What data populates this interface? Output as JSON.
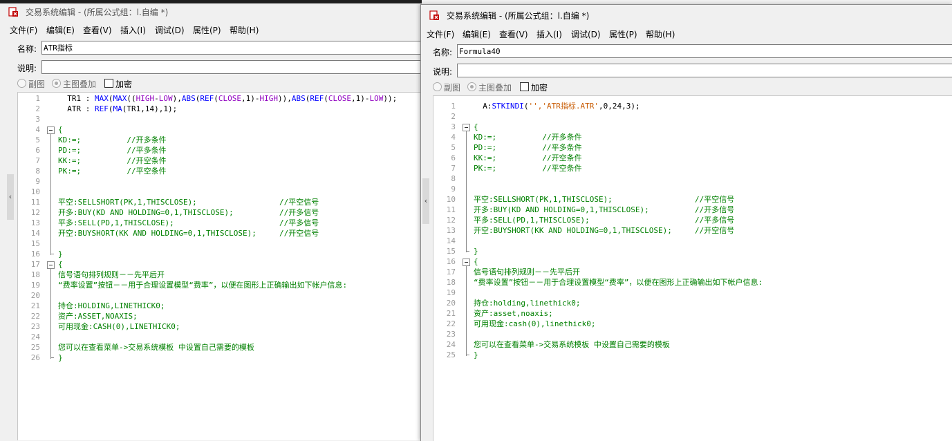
{
  "left": {
    "title": "交易系统编辑 - (所属公式组：l.自编 *)",
    "menu": [
      "文件(F)",
      "编辑(E)",
      "查看(V)",
      "插入(I)",
      "调试(D)",
      "属性(P)",
      "帮助(H)"
    ],
    "name_label": "名称:",
    "name_value": "ATR指标",
    "desc_label": "说明:",
    "desc_value": "",
    "options": {
      "sub": "副图",
      "main": "主图叠加",
      "encrypt": "加密"
    },
    "lines": [
      [
        "  TR1 : ",
        "MAX",
        "(",
        "MAX",
        "((",
        "HIGH",
        "-",
        "LOW",
        "),",
        "ABS",
        "(",
        "REF",
        "(",
        "CLOSE",
        ",1)-",
        "HIGH",
        ")),",
        "ABS",
        "(",
        "REF",
        "(",
        "CLOSE",
        ",1)-",
        "LOW",
        "));"
      ],
      [
        "  ATR : ",
        "REF",
        "(",
        "MA",
        "(TR1,14),1);"
      ],
      [
        ""
      ],
      [
        "{"
      ],
      [
        "KD:=;          //开多条件"
      ],
      [
        "PD:=;          //平多条件"
      ],
      [
        "KK:=;          //开空条件"
      ],
      [
        "PK:=;          //平空条件"
      ],
      [
        ""
      ],
      [
        ""
      ],
      [
        "平空:SELLSHORT(PK,1,THISCLOSE);                  //平空信号"
      ],
      [
        "开多:BUY(KD AND HOLDING=0,1,THISCLOSE);          //开多信号"
      ],
      [
        "平多:SELL(PD,1,THISCLOSE);                       //平多信号"
      ],
      [
        "开空:BUYSHORT(KK AND HOLDING=0,1,THISCLOSE);     //开空信号"
      ],
      [
        ""
      ],
      [
        "}"
      ],
      [
        "{"
      ],
      [
        "信号语句排列规则－－先平后开"
      ],
      [
        "“费率设置”按钮－－用于合理设置模型“费率”，以便在图形上正确输出如下帐户信息:"
      ],
      [
        ""
      ],
      [
        "持仓:HOLDING,LINETHICK0;"
      ],
      [
        "资产:ASSET,NOAXIS;"
      ],
      [
        "可用现金:CASH(0),LINETHICK0;"
      ],
      [
        ""
      ],
      [
        "您可以在查看菜单->交易系统模板 中设置自己需要的模板"
      ],
      [
        "}"
      ]
    ]
  },
  "right": {
    "title": "交易系统编辑 - (所属公式组：l.自编 *)",
    "menu": [
      "文件(F)",
      "编辑(E)",
      "查看(V)",
      "插入(I)",
      "调试(D)",
      "属性(P)",
      "帮助(H)"
    ],
    "name_label": "名称:",
    "name_value": "Formula40",
    "desc_label": "说明:",
    "desc_value": "",
    "options": {
      "sub": "副图",
      "main": "主图叠加",
      "encrypt": "加密"
    },
    "lines": [
      [
        "  A:",
        "STKINDI",
        "('','ATR指标.ATR',0,24,3);"
      ],
      [
        ""
      ],
      [
        "{"
      ],
      [
        "KD:=;          //开多条件"
      ],
      [
        "PD:=;          //平多条件"
      ],
      [
        "KK:=;          //开空条件"
      ],
      [
        "PK:=;          //平空条件"
      ],
      [
        ""
      ],
      [
        ""
      ],
      [
        "平空:SELLSHORT(PK,1,THISCLOSE);                  //平空信号"
      ],
      [
        "开多:BUY(KD AND HOLDING=0,1,THISCLOSE);          //开多信号"
      ],
      [
        "平多:SELL(PD,1,THISCLOSE);                       //平多信号"
      ],
      [
        "开空:BUYSHORT(KK AND HOLDING=0,1,THISCLOSE);     //开空信号"
      ],
      [
        ""
      ],
      [
        "}"
      ],
      [
        "{"
      ],
      [
        "信号语句排列规则－－先平后开"
      ],
      [
        "“费率设置”按钮－－用于合理设置模型“费率”，以便在图形上正确输出如下帐户信息:"
      ],
      [
        ""
      ],
      [
        "持仓:holding,linethick0;"
      ],
      [
        "资产:asset,noaxis;"
      ],
      [
        "可用现金:cash(0),linethick0;"
      ],
      [
        ""
      ],
      [
        "您可以在查看菜单->交易系统模板 中设置自己需要的模板"
      ],
      [
        "}"
      ]
    ]
  },
  "colors": {
    "black": "#000000",
    "green": "#008000",
    "blue": "#0000ff",
    "purple": "#9000c0",
    "orange": "#c85a00"
  }
}
